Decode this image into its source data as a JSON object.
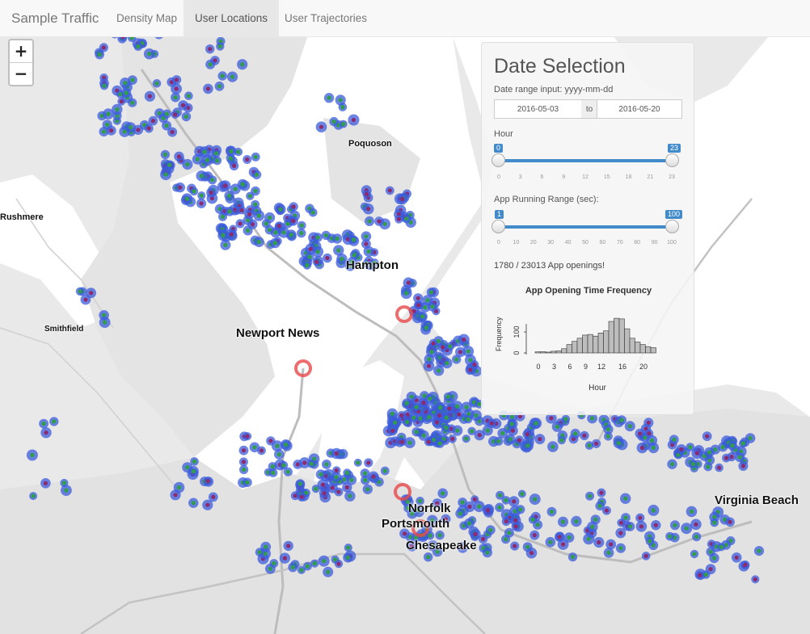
{
  "app": {
    "title": "Sample Traffic"
  },
  "tabs": [
    {
      "label": "Density Map",
      "active": false
    },
    {
      "label": "User Locations",
      "active": true
    },
    {
      "label": "User Trajectories",
      "active": false
    }
  ],
  "map": {
    "zoom_in_label": "+",
    "zoom_out_label": "−",
    "cities": {
      "poquoson": "Poquoson",
      "rushmere": "Rushmere",
      "smithfield": "Smithfield",
      "newport_news": "Newport News",
      "hampton": "Hampton",
      "norfolk": "Norfolk",
      "portsmouth": "Portsmouth",
      "chesapeake": "Chesapeake",
      "virginia_beach": "Virginia Beach"
    },
    "marker_colors": {
      "ring": "#3b5bdb",
      "core_a": "#2e9e48",
      "core_b": "#8e2a6e",
      "highlight": "#e8484a"
    }
  },
  "panel": {
    "title": "Date Selection",
    "date_label": "Date range input: yyyy-mm-dd",
    "start_date": "2016-05-03",
    "end_date": "2016-05-20",
    "date_separator": "to",
    "hour": {
      "label": "Hour",
      "min": "0",
      "max": "23",
      "ticks": [
        "0",
        "3",
        "6",
        "9",
        "12",
        "15",
        "18",
        "21",
        "23"
      ]
    },
    "app_range": {
      "label": "App Running Range (sec):",
      "min": "1",
      "max": "100",
      "ticks": [
        "0",
        "10",
        "20",
        "30",
        "40",
        "50",
        "60",
        "70",
        "80",
        "90",
        "100"
      ]
    },
    "status_text": "1780 / 23013 App openings!"
  },
  "chart_data": {
    "type": "bar",
    "title": "App Opening Time Frequency",
    "xlabel": "Hour",
    "ylabel": "Frequency",
    "x_ticks": [
      "0",
      "3",
      "6",
      "9",
      "12",
      "15",
      "18",
      "21"
    ],
    "x_tick_labels": [
      "0",
      "3",
      "6",
      "9",
      "12",
      "16",
      "20"
    ],
    "y_ticks": [
      "0",
      "100"
    ],
    "ylim": [
      0,
      200
    ],
    "bin_width": 1,
    "x_start": 0,
    "values": [
      5,
      6,
      4,
      8,
      10,
      20,
      40,
      55,
      70,
      85,
      88,
      80,
      95,
      105,
      150,
      165,
      162,
      115,
      70,
      52,
      40,
      30,
      25
    ]
  }
}
